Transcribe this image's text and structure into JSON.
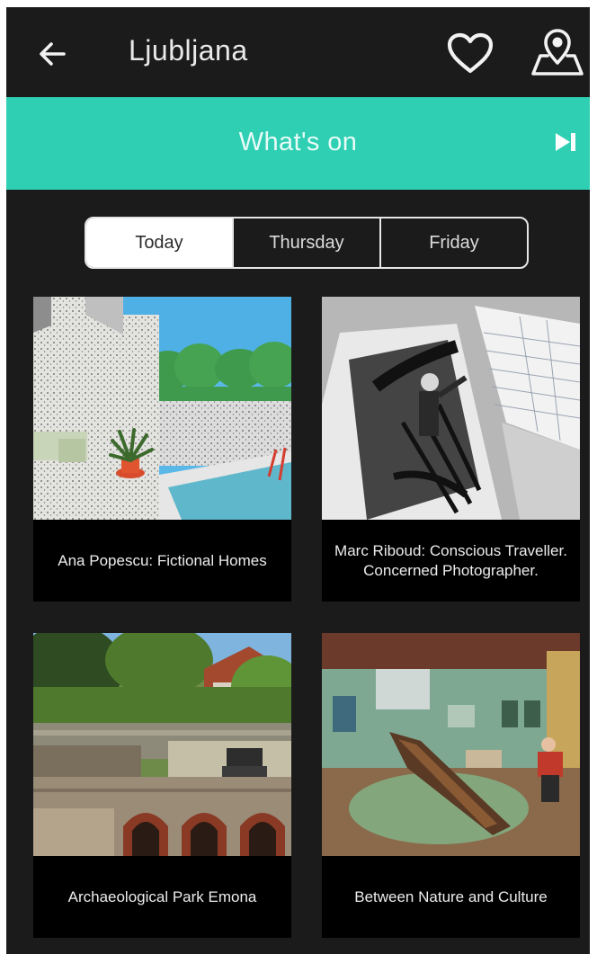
{
  "header": {
    "title": "Ljubljana",
    "back_icon": "arrow-left-icon",
    "favorite_icon": "heart-outline-icon",
    "map_icon": "map-pin-icon"
  },
  "banner": {
    "title": "What's on",
    "skip_icon": "skip-next-icon",
    "color": "#2ecfb3"
  },
  "day_tabs": [
    {
      "label": "Today",
      "selected": true
    },
    {
      "label": "Thursday",
      "selected": false
    },
    {
      "label": "Friday",
      "selected": false
    }
  ],
  "events": [
    {
      "title": "Ana Popescu: Fictional Homes",
      "image": "painting of white pool house with plant"
    },
    {
      "title": "Marc Riboud: Conscious Traveller. Concerned Photographer.",
      "image": "open book with black-and-white photo of painter on Eiffel Tower"
    },
    {
      "title": "Archaeological Park Emona",
      "image": "roman stone ruins with brick arches"
    },
    {
      "title": "Between Nature and Culture",
      "image": "museum hall with ancient dugout boat"
    }
  ]
}
